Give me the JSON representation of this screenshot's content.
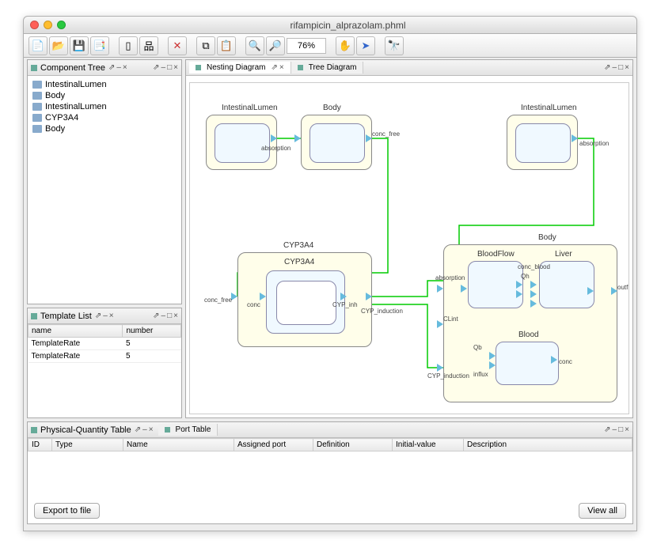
{
  "title": "rifampicin_alprazolam.phml",
  "zoom": "76%",
  "panels": {
    "componentTree": {
      "title": "Component Tree",
      "items": [
        "IntestinalLumen",
        "Body",
        "IntestinalLumen",
        "CYP3A4",
        "Body"
      ]
    },
    "templateList": {
      "title": "Template List",
      "columns": [
        "name",
        "number"
      ],
      "rows": [
        {
          "name": "TemplateRate",
          "number": "5"
        },
        {
          "name": "TemplateRate",
          "number": "5"
        }
      ]
    },
    "diagram": {
      "tabs": [
        "Nesting Diagram",
        "Tree Diagram"
      ],
      "active": 0,
      "nodes": {
        "il1": "IntestinalLumen",
        "body1": "Body",
        "il2": "IntestinalLumen",
        "cyp_out": "CYP3A4",
        "cyp_in": "CYP3A4",
        "body2": "Body",
        "bloodflow": "BloodFlow",
        "liver": "Liver",
        "blood": "Blood"
      },
      "ports": {
        "absorption": "absorption",
        "conc_free": "conc_free",
        "conc": "conc",
        "cyp_induction": "CYP_induction",
        "clint": "CLint",
        "qh": "Qh",
        "qb": "Qb",
        "influx": "influx",
        "outflux": "outflux",
        "conc_blood": "conc_blood",
        "cyp_init": "CYP_inh"
      }
    },
    "pqTable": {
      "title": "Physical-Quantity Table",
      "tabs": [
        "Port Table"
      ],
      "columns": [
        "ID",
        "Type",
        "Name",
        "Assigned port",
        "Definition",
        "Initial-value",
        "Description"
      ],
      "btnExport": "Export to file",
      "btnViewAll": "View all"
    }
  }
}
